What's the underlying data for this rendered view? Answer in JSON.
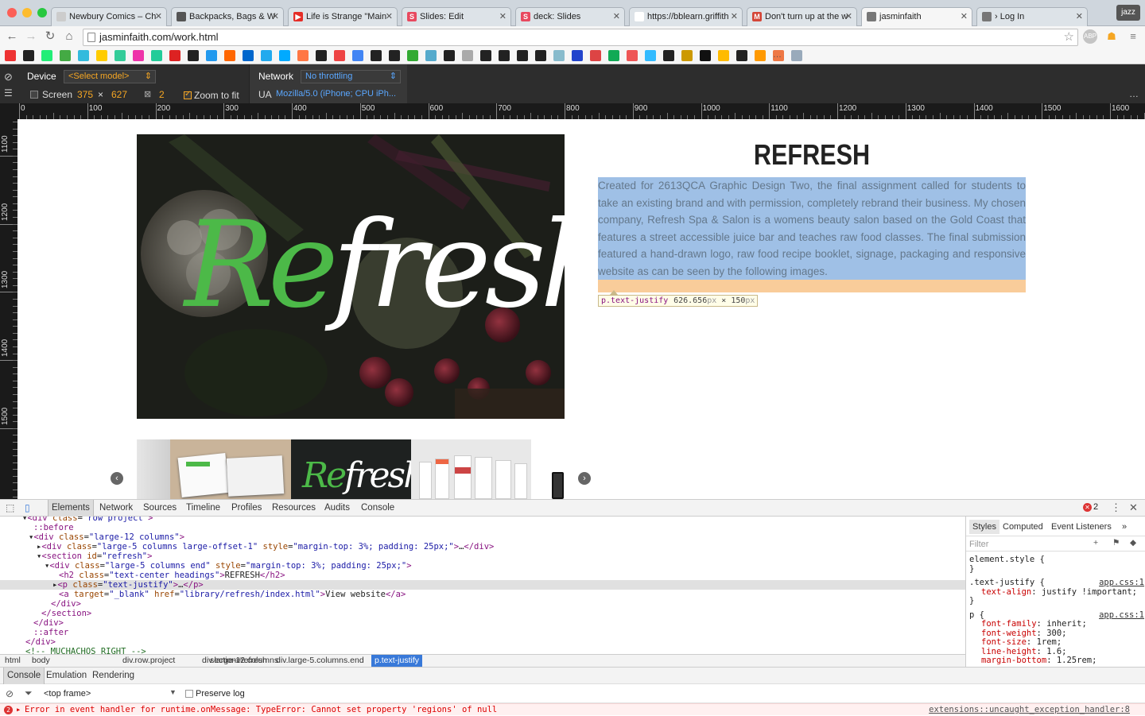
{
  "browser": {
    "tabs": [
      {
        "title": "Newbury Comics – Ch",
        "fav_color": "#cccccc",
        "fav_glyph": "",
        "active": false
      },
      {
        "title": "Backpacks, Bags & W",
        "fav_color": "#555555",
        "fav_glyph": "",
        "active": false
      },
      {
        "title": "Life is Strange \"Main",
        "fav_color": "#e52d27",
        "fav_glyph": "▶",
        "active": false
      },
      {
        "title": "Slides: Edit",
        "fav_color": "#e8495f",
        "fav_glyph": "S",
        "active": false
      },
      {
        "title": "deck: Slides",
        "fav_color": "#e8495f",
        "fav_glyph": "S",
        "active": false
      },
      {
        "title": "https://bblearn.griffith",
        "fav_color": "#ffffff",
        "fav_glyph": "",
        "active": false
      },
      {
        "title": "Don't turn up at the w",
        "fav_color": "#d44638",
        "fav_glyph": "M",
        "active": false
      },
      {
        "title": "jasminfaith",
        "fav_color": "#777777",
        "fav_glyph": "",
        "active": true
      },
      {
        "title": "› Log In",
        "fav_color": "#777777",
        "fav_glyph": "",
        "active": false
      }
    ],
    "profile_label": "jazz",
    "url": "jasminfaith.com/work.html",
    "bookmark_colors": [
      "#e33",
      "#222",
      "#2e7",
      "#4a4",
      "#3bd",
      "#fc0",
      "#3c9",
      "#e3a",
      "#2c9",
      "#d22",
      "#222",
      "#29e",
      "#f60",
      "#06c",
      "#2ae",
      "#0af",
      "#f74",
      "#222",
      "#e44",
      "#4285f4",
      "#222",
      "#222",
      "#3a3",
      "#5ac",
      "#222",
      "#aaa",
      "#222",
      "#222",
      "#222",
      "#222",
      "#8bc",
      "#24c",
      "#d44",
      "#1a5",
      "#e55",
      "#3bf",
      "#222",
      "#c90",
      "#111",
      "#fb0",
      "#222",
      "#f90",
      "#e74",
      "#9ab"
    ]
  },
  "device_toolbar": {
    "device_label": "Device",
    "device_value": "<Select model>",
    "screen_label": "Screen",
    "screen_width": "375",
    "screen_times": "×",
    "screen_height": "627",
    "dpr": "2",
    "zoom_label": "Zoom to fit",
    "network_label": "Network",
    "network_value": "No throttling",
    "ua_label": "UA",
    "ua_value": "Mozilla/5.0 (iPhone; CPU iPh..."
  },
  "ruler": {
    "top_labels": [
      "0",
      "100",
      "200",
      "300",
      "400",
      "500",
      "600",
      "700",
      "800",
      "900",
      "1000",
      "1100",
      "1200",
      "1300",
      "1400",
      "1500",
      "1600"
    ],
    "left_labels": [
      "1100",
      "1200",
      "1300",
      "1400",
      "1500"
    ]
  },
  "page": {
    "hero_word": "Refresh",
    "hero_word_green": "Re",
    "hero_word_white": "fresh",
    "heading": "REFRESH",
    "description": "Created for 2613QCA Graphic Design Two, the final assignment called for students to take an existing brand and with permission, completely rebrand their business. My chosen company, Refresh Spa & Salon is a womens beauty salon based on the Gold Coast that features a street accessible juice bar and teaches raw food classes. The final submission featured a hand-drawn logo, raw food recipe booklet, signage, packaging and responsive website as can be seen by the following images.",
    "tooltip_selector": "p.text-justify",
    "tooltip_width": "626.656",
    "tooltip_px1": "px",
    "tooltip_times": " × ",
    "tooltip_height": "150",
    "tooltip_px2": "px",
    "carousel_prev": "‹",
    "carousel_next": "›",
    "thumb_word": "Refresh"
  },
  "devtools": {
    "tabs": [
      "Elements",
      "Network",
      "Sources",
      "Timeline",
      "Profiles",
      "Resources",
      "Audits",
      "Console"
    ],
    "active_tab": "Elements",
    "error_count": "2",
    "dom_lines": [
      {
        "indent": 28,
        "html": "▾<span class='tg'>&lt;div</span> <span class='at'>class</span>=<span class='av'>\"row project\"</span><span class='tg'>&gt;</span>"
      },
      {
        "indent": 42,
        "html": "<span class='tg'>::before</span>"
      },
      {
        "indent": 36,
        "html": "▾<span class='tg'>&lt;div</span> <span class='at'>class</span>=<span class='av'>\"large-12 columns\"</span><span class='tg'>&gt;</span>"
      },
      {
        "indent": 46,
        "html": "▸<span class='tg'>&lt;div</span> <span class='at'>class</span>=<span class='av'>\"large-5 columns large-offset-1\"</span> <span class='at'>style</span>=<span class='av'>\"margin-top: 3%; padding: 25px;\"</span><span class='tg'>&gt;</span>…<span class='tg'>&lt;/div&gt;</span>"
      },
      {
        "indent": 46,
        "html": "▾<span class='tg'>&lt;section</span> <span class='at'>id</span>=<span class='av'>\"refresh\"</span><span class='tg'>&gt;</span>"
      },
      {
        "indent": 56,
        "html": "▾<span class='tg'>&lt;div</span> <span class='at'>class</span>=<span class='av'>\"large-5 columns end\"</span> <span class='at'>style</span>=<span class='av'>\"margin-top: 3%; padding: 25px;\"</span><span class='tg'>&gt;</span>"
      },
      {
        "indent": 74,
        "html": "<span class='tg'>&lt;h2</span> <span class='at'>class</span>=<span class='av'>\"text-center headings\"</span><span class='tg'>&gt;</span>REFRESH<span class='tg'>&lt;/h2&gt;</span>"
      },
      {
        "indent": 66,
        "html": "▸<span class='tg'>&lt;p</span> <span class='at'>class</span>=<span class='av'>\"text-justify\"</span><span class='tg'>&gt;</span>…<span class='tg'>&lt;/p&gt;</span>",
        "selected": true
      },
      {
        "indent": 74,
        "html": "<span class='tg'>&lt;a</span> <span class='at'>target</span>=<span class='av'>\"_blank\"</span> <span class='at'>href</span>=<span class='av'>\"library/refresh/index.html\"</span><span class='tg'>&gt;</span>View website<span class='tg'>&lt;/a&gt;</span>"
      },
      {
        "indent": 64,
        "html": "<span class='tg'>&lt;/div&gt;</span>"
      },
      {
        "indent": 52,
        "html": "<span class='tg'>&lt;/section&gt;</span>"
      },
      {
        "indent": 42,
        "html": "<span class='tg'>&lt;/div&gt;</span>"
      },
      {
        "indent": 42,
        "html": "<span class='tg'>::after</span>"
      },
      {
        "indent": 32,
        "html": "<span class='tg'>&lt;/div&gt;</span>"
      },
      {
        "indent": 32,
        "html": "<span class='cm'>&lt;!-- MUCHACHOS RIGHT --&gt;</span>"
      }
    ],
    "breadcrumbs": [
      "html",
      "body",
      "div.row.project",
      "div.large-12.columns",
      "section#refresh",
      "div.large-5.columns.end",
      "p.text-justify"
    ],
    "styles_tabs": [
      "Styles",
      "Computed",
      "Event Listeners",
      "»"
    ],
    "styles_filter_placeholder": "Filter",
    "css_rules": [
      {
        "selector": "element.style {",
        "source": "",
        "props": [],
        "close": "}"
      },
      {
        "selector": ".text-justify {",
        "source": "app.css:1",
        "props": [
          {
            "name": "text-align",
            "value": "justify !important;"
          }
        ],
        "close": "}"
      },
      {
        "selector": "p {",
        "source": "app.css:1",
        "props": [
          {
            "name": "font-family",
            "value": "inherit;"
          },
          {
            "name": "font-weight",
            "value": "300;"
          },
          {
            "name": "font-size",
            "value": "1rem;"
          },
          {
            "name": "line-height",
            "value": "1.6;"
          },
          {
            "name": "margin-bottom",
            "value": "1.25rem;"
          }
        ],
        "close": ""
      }
    ],
    "drawer_tabs": [
      "Console",
      "Emulation",
      "Rendering"
    ],
    "frame_select": "<top frame>",
    "preserve_log": "Preserve log",
    "error_text": "Error in event handler for runtime.onMessage: TypeError: Cannot set property 'regions' of null",
    "error_source": "extensions::uncaught_exception_handler:8"
  }
}
